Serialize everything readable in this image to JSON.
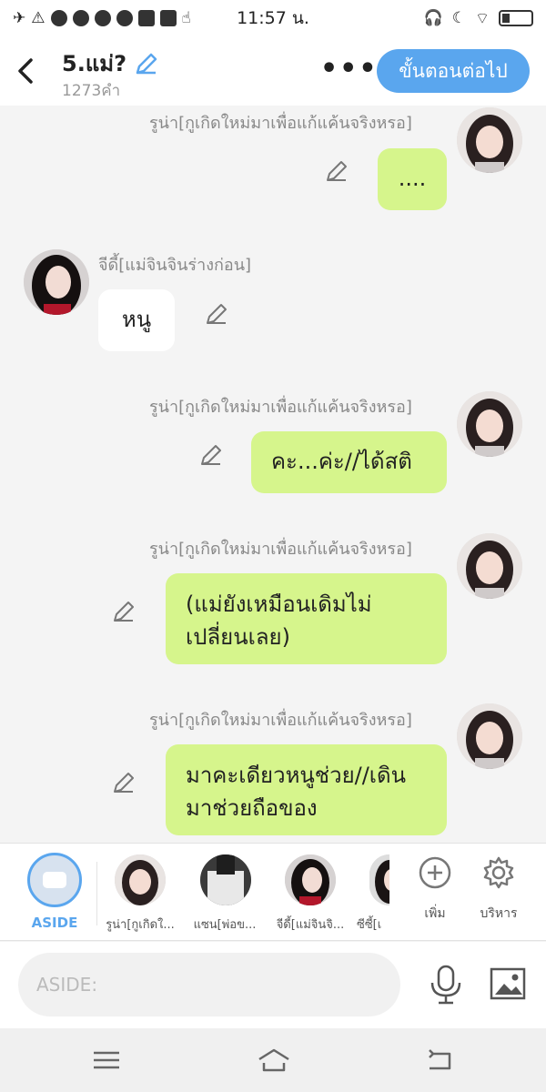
{
  "status_bar": {
    "time": "11:57 น."
  },
  "header": {
    "title": "5.แม่?",
    "word_count": "1273คำ",
    "more_label": "•••",
    "next_button": "ขั้นตอนต่อไป"
  },
  "messages": [
    {
      "sender": "รูน่า[กูเกิดใหม่มาเพื่อแก้แค้นจริงหรอ]",
      "text": "....",
      "side": "right"
    },
    {
      "sender": "จีดี้[แม่จินจินร่างก่อน]",
      "text": "หนู",
      "side": "left"
    },
    {
      "sender": "รูน่า[กูเกิดใหม่มาเพื่อแก้แค้นจริงหรอ]",
      "text": "คะ...ค่ะ//ได้สติ",
      "side": "right"
    },
    {
      "sender": "รูน่า[กูเกิดใหม่มาเพื่อแก้แค้นจริงหรอ]",
      "text": "(แม่ยังเหมือนเดิมไม่เปลี่ยนเลย)",
      "side": "right"
    },
    {
      "sender": "รูน่า[กูเกิดใหม่มาเพื่อแก้แค้นจริงหรอ]",
      "text": "มาคะเดียวหนูช่วย//เดินมาช่วยถือของ",
      "side": "right"
    }
  ],
  "character_strip": {
    "aside_label": "ASIDE",
    "characters": [
      {
        "label": "รูน่า[กูเกิดใ..."
      },
      {
        "label": "แซน[พ่อข..."
      },
      {
        "label": "จีดี้[แม่จินจิ..."
      },
      {
        "label": "ซีซี้[เ"
      }
    ],
    "add_label": "เพิ่ม",
    "manage_label": "บริหาร"
  },
  "input": {
    "placeholder": "ASIDE:"
  },
  "colors": {
    "accent": "#5aa6ee",
    "my_bubble": "#d6f58c",
    "other_bubble": "#ffffff",
    "background": "#f4f4f4"
  }
}
